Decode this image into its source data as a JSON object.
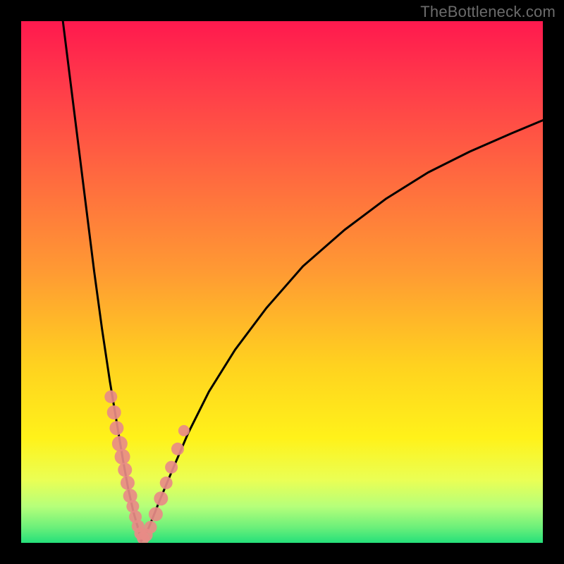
{
  "watermark": "TheBottleneck.com",
  "chart_data": {
    "type": "line",
    "title": "",
    "xlabel": "",
    "ylabel": "",
    "xlim": [
      0,
      100
    ],
    "ylim": [
      0,
      100
    ],
    "grid": false,
    "legend": false,
    "notes": "Axes are unlabeled; values are estimated from pixel position on a 0–100 scale. Background is a vertical gradient (magenta→orange→yellow→green). Two black curves descend toward a minimum near x≈23 where y≈0, forming a V; salmon dots sit on both branches near the minimum.",
    "gradient_stops": [
      {
        "offset": 0.0,
        "color": "#ff194e"
      },
      {
        "offset": 0.12,
        "color": "#ff3a4a"
      },
      {
        "offset": 0.3,
        "color": "#ff6a3f"
      },
      {
        "offset": 0.48,
        "color": "#ff9a33"
      },
      {
        "offset": 0.66,
        "color": "#ffd21f"
      },
      {
        "offset": 0.8,
        "color": "#fff21a"
      },
      {
        "offset": 0.88,
        "color": "#eaff55"
      },
      {
        "offset": 0.93,
        "color": "#b6ff7a"
      },
      {
        "offset": 0.97,
        "color": "#6cf07a"
      },
      {
        "offset": 1.0,
        "color": "#25e07a"
      }
    ],
    "series": [
      {
        "name": "left-branch",
        "x": [
          8.0,
          9.5,
          11.0,
          12.5,
          14.0,
          15.5,
          17.0,
          18.5,
          19.5,
          20.5,
          21.5,
          22.5,
          23.0
        ],
        "y": [
          100.0,
          88.0,
          76.0,
          64.0,
          52.0,
          41.0,
          31.0,
          22.0,
          16.0,
          10.5,
          6.0,
          2.5,
          0.3
        ]
      },
      {
        "name": "right-branch",
        "x": [
          23.0,
          24.5,
          26.5,
          29.0,
          32.0,
          36.0,
          41.0,
          47.0,
          54.0,
          62.0,
          70.0,
          78.0,
          86.0,
          94.0,
          100.0
        ],
        "y": [
          0.3,
          3.0,
          8.0,
          14.0,
          21.0,
          29.0,
          37.0,
          45.0,
          53.0,
          60.0,
          66.0,
          71.0,
          75.0,
          78.5,
          81.0
        ]
      }
    ],
    "points": {
      "name": "highlight-dots",
      "x": [
        17.2,
        17.8,
        18.3,
        18.9,
        19.4,
        19.9,
        20.4,
        20.9,
        21.4,
        21.9,
        22.4,
        22.9,
        23.4,
        24.0,
        24.8,
        25.8,
        26.8,
        27.8,
        28.8,
        30.0,
        31.2
      ],
      "y": [
        28.0,
        25.0,
        22.0,
        19.0,
        16.5,
        14.0,
        11.5,
        9.0,
        7.0,
        5.0,
        3.2,
        1.8,
        0.9,
        1.5,
        3.0,
        5.5,
        8.5,
        11.5,
        14.5,
        18.0,
        21.5
      ],
      "r": [
        9,
        10,
        10,
        11,
        11,
        10,
        10,
        10,
        9,
        9,
        9,
        9,
        9,
        9,
        9,
        10,
        10,
        9,
        9,
        9,
        8
      ]
    }
  }
}
